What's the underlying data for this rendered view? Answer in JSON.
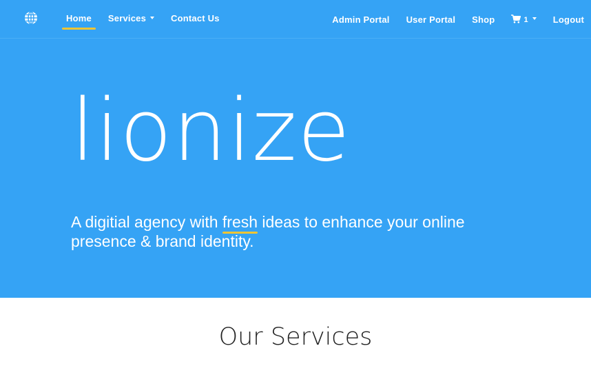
{
  "nav": {
    "brand_icon": "globe-icon",
    "left": [
      {
        "label": "Home",
        "active": true
      },
      {
        "label": "Services",
        "dropdown": true
      },
      {
        "label": "Contact Us"
      }
    ],
    "right": {
      "admin_portal": "Admin Portal",
      "user_portal": "User Portal",
      "shop": "Shop",
      "cart_icon": "shopping-cart-icon",
      "cart_count": "1",
      "logout": "Logout"
    }
  },
  "hero": {
    "title": "lionize",
    "subtitle_before": "A digitial agency with ",
    "subtitle_highlight": "fresh",
    "subtitle_after": " ideas to enhance your online presence & brand identity."
  },
  "services": {
    "title": "Our Services"
  },
  "colors": {
    "primary": "#35a3f5",
    "accent": "#f2c534",
    "text_dark": "#222222"
  }
}
